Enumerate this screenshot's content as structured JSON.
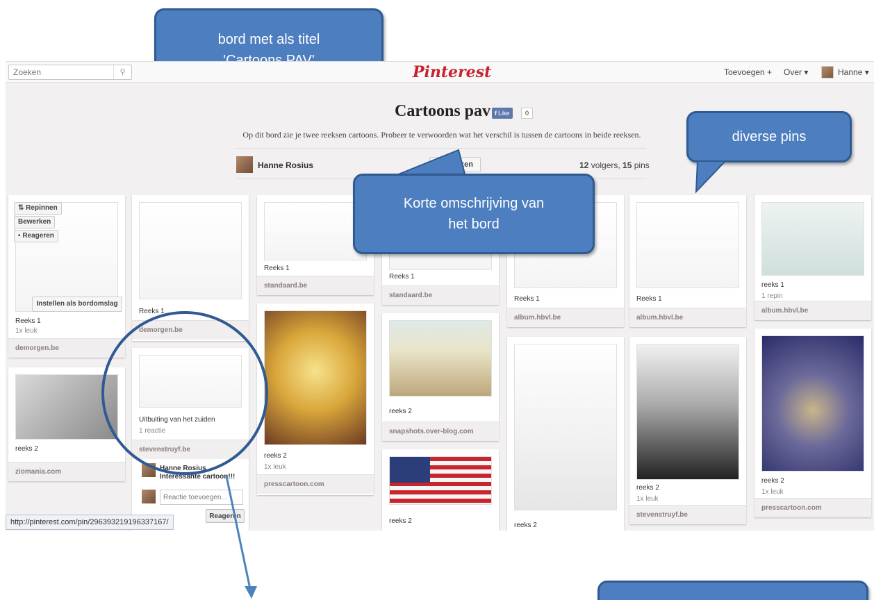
{
  "topbar": {
    "search_placeholder": "Zoeken",
    "search_icon": "magnifier-icon",
    "logo": "Pinterest",
    "add_label": "Toevoegen  +",
    "about_label": "Over  ▾",
    "user_label": "Hanne  ▾"
  },
  "board": {
    "title": "Cartoons pav",
    "fb_like": "Like",
    "fb_count": "0",
    "description": "Op dit bord zie je twee reeksen cartoons. Probeer te verwoorden wat het verschil is tussen de cartoons in beide reeksen.",
    "owner": "Hanne Rosius",
    "edit_label": "Bewerken",
    "followers": "12",
    "followers_word": " volgers, ",
    "pins": "15",
    "pins_word": " pins"
  },
  "hover_actions": {
    "repin": "Repinnen",
    "edit": "Bewerken",
    "comment": "Reageren",
    "set_cover": "Instellen als bordomslag"
  },
  "pins": [
    {
      "caption": "Reeks 1",
      "meta": "1x leuk",
      "source": "demorgen.be"
    },
    {
      "caption": "reeks 2",
      "meta": "",
      "source": "ziomania.com"
    },
    {
      "caption": "Reeks 1",
      "meta": "",
      "source": "demorgen.be"
    },
    {
      "caption": "Uitbuiting van het zuiden",
      "meta": "1 reactie",
      "source": "stevenstruyf.be"
    },
    {
      "caption": "Reeks 1",
      "meta": "",
      "source": "standaard.be"
    },
    {
      "caption": "reeks 2",
      "meta": "1x leuk",
      "source": "presscartoon.com"
    },
    {
      "caption": "Reeks 1",
      "meta": "",
      "source": "standaard.be"
    },
    {
      "caption": "reeks 2",
      "meta": "",
      "source": "snapshots.over-blog.com"
    },
    {
      "caption": "reeks 2",
      "meta": "",
      "source": ""
    },
    {
      "caption": "Reeks 1",
      "meta": "",
      "source": "album.hbvl.be"
    },
    {
      "caption": "reeks 2",
      "meta": "",
      "source": ""
    },
    {
      "caption": "Reeks 1",
      "meta": "",
      "source": "album.hbvl.be"
    },
    {
      "caption": "reeks 2",
      "meta": "1x leuk",
      "source": "stevenstruyf.be"
    },
    {
      "caption": "reeks 1",
      "meta": "1 repin",
      "source": "album.hbvl.be"
    },
    {
      "caption": "reeks 2",
      "meta": "1x leuk",
      "source": "presscartoon.com"
    }
  ],
  "comment": {
    "author": "Hanne Rosius",
    "text": "Interessante cartoon!!!",
    "input_placeholder": "Reactie toevoegen...",
    "submit": "Reageren"
  },
  "statusbar": "http://pinterest.com/pin/296393219196337167/",
  "callouts": {
    "title": "bord met als titel 'Cartoons PAV'",
    "title_line1": "bord met als titel",
    "title_line2": "'Cartoons PAV'",
    "description_line1": "Korte omschrijving van",
    "description_line2": "het bord",
    "pins": "diverse pins"
  },
  "colors": {
    "callout_fill": "#4d7ec0",
    "callout_border": "#2f5a92",
    "pinterest_red": "#c8232c"
  }
}
